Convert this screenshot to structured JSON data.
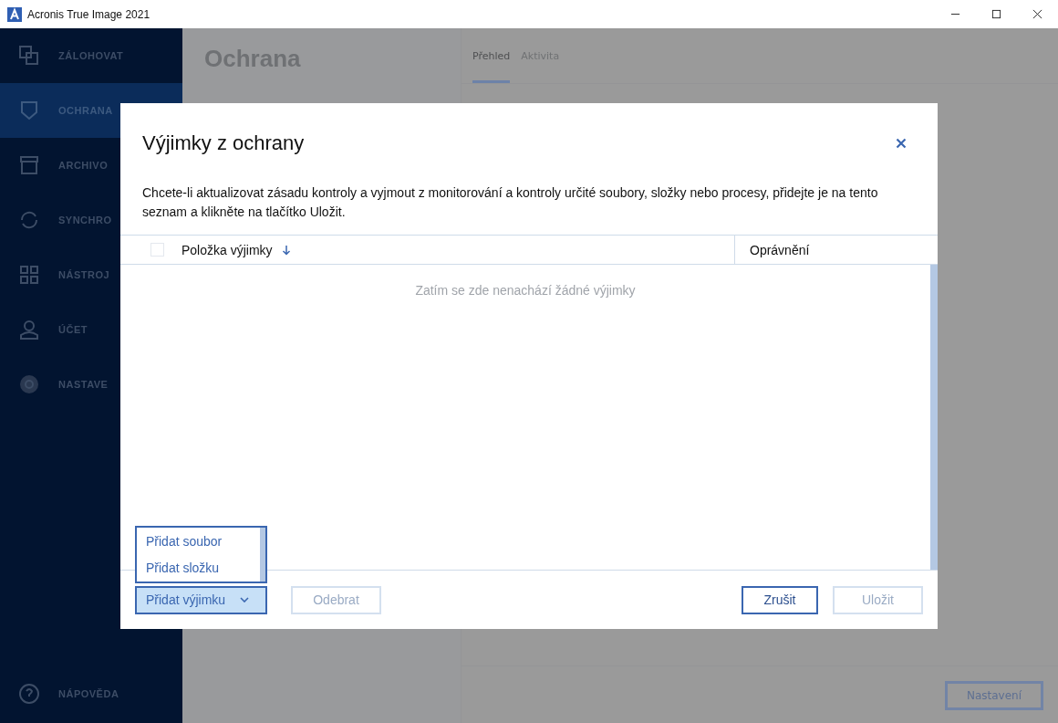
{
  "window": {
    "title": "Acronis True Image 2021"
  },
  "sidebar": {
    "items": [
      {
        "label": "ZÁLOHOVAT",
        "kind": "backup",
        "selected": false
      },
      {
        "label": "OCHRANA",
        "kind": "protect",
        "selected": true
      },
      {
        "label": "ARCHIVO",
        "kind": "archive",
        "selected": false
      },
      {
        "label": "SYNCHRO",
        "kind": "sync",
        "selected": false
      },
      {
        "label": "NÁSTROJ",
        "kind": "tools",
        "selected": false
      },
      {
        "label": "ÚČET",
        "kind": "account",
        "selected": false
      },
      {
        "label": "NASTAVE",
        "kind": "settings",
        "selected": false
      }
    ],
    "help": "NÁPOVĚDA"
  },
  "page": {
    "title": "Ochrana",
    "tabs": [
      {
        "label": "Přehled",
        "selected": true
      },
      {
        "label": "Aktivita",
        "selected": false
      }
    ],
    "settings_button": "Nastavení"
  },
  "dialog": {
    "title": "Výjimky z ochrany",
    "description": "Chcete-li aktualizovat zásadu kontroly a vyjmout z monitorování a kontroly určité soubory, složky nebo procesy, přidejte je na tento seznam a klikněte na tlačítko Uložit.",
    "table": {
      "select_all_checked": false,
      "columns": [
        "Položka výjimky",
        "Oprávnění"
      ],
      "empty_message": "Zatím se zde nenachází žádné výjimky"
    },
    "add_menu": {
      "label": "Přidat výjimku",
      "expanded": true,
      "items": [
        "Přidat soubor",
        "Přidat složku"
      ]
    },
    "buttons": [
      {
        "label": "Odebrat",
        "disabled": true,
        "kind": "left"
      },
      {
        "label": "Zrušit",
        "disabled": false,
        "kind": "right"
      },
      {
        "label": "Uložit",
        "disabled": true,
        "kind": "right"
      }
    ]
  }
}
